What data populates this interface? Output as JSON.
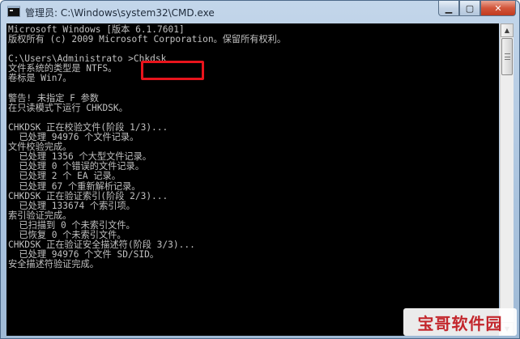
{
  "window": {
    "title": "管理员: C:\\Windows\\system32\\CMD.exe",
    "minimize_glyph": "▁",
    "maximize_glyph": "▢",
    "close_glyph": "✕"
  },
  "console": {
    "lines": [
      "Microsoft Windows [版本 6.1.7601]",
      "版权所有 (c) 2009 Microsoft Corporation。保留所有权利。",
      "",
      "C:\\Users\\Administrato >Chkdsk",
      "文件系统的类型是 NTFS。",
      "卷标是 Win7。",
      "",
      "警告! 未指定 F 参数",
      "在只读模式下运行 CHKDSK。",
      "",
      "CHKDSK 正在校验文件(阶段 1/3)...",
      "  已处理 94976 个文件记录。",
      "文件校验完成。",
      "  已处理 1356 个大型文件记录。",
      "  已处理 0 个错误的文件记录。",
      "  已处理 2 个 EA 记录。",
      "  已处理 67 个重新解析记录。",
      "CHKDSK 正在验证索引(阶段 2/3)...",
      "  已处理 133674 个索引项。",
      "索引验证完成。",
      "  已扫描到 0 个未索引文件。",
      "  已恢复 0 个未索引文件。",
      "CHKDSK 正在验证安全描述符(阶段 3/3)...",
      "  已处理 94976 个文件 SD/SID。",
      "安全描述符验证完成。"
    ],
    "text_color": "#c0c0c0",
    "background": "#000000",
    "highlight_color": "#e8141c"
  },
  "scrollbar": {
    "up_glyph": "▲",
    "down_glyph": "▼"
  },
  "watermark": {
    "text": "宝哥软件园"
  }
}
